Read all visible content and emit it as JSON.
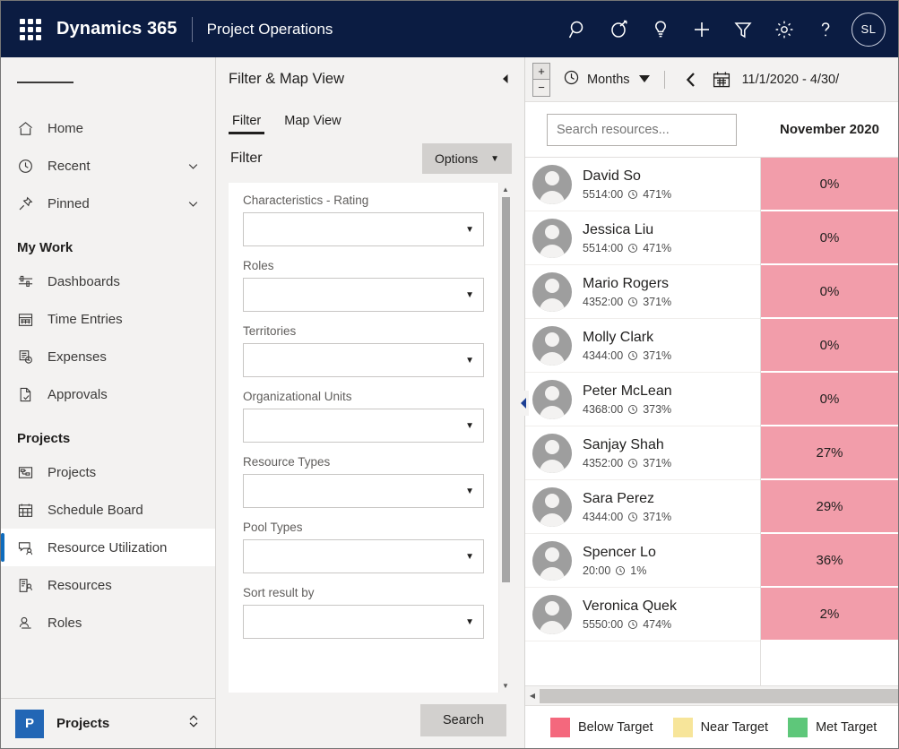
{
  "topbar": {
    "waffle_title": "App launcher",
    "brand": "Dynamics 365",
    "app_name": "Project Operations",
    "icons": [
      "search-icon",
      "assistant-icon",
      "idea-icon",
      "plus-icon",
      "filter-icon",
      "gear-icon",
      "help-icon"
    ],
    "avatar_initials": "SL",
    "background_color": "#0b1c42"
  },
  "sidebar": {
    "hamburger": "Expand/collapse navigation",
    "quick_items": [
      {
        "label": "Home",
        "icon": "home-icon",
        "chevron": false
      },
      {
        "label": "Recent",
        "icon": "clock-icon",
        "chevron": true
      },
      {
        "label": "Pinned",
        "icon": "pin-icon",
        "chevron": true
      }
    ],
    "groups": [
      {
        "title": "My Work",
        "items": [
          {
            "label": "Dashboards",
            "icon": "dashboard-icon",
            "selected": false
          },
          {
            "label": "Time Entries",
            "icon": "calendar-icon",
            "selected": false
          },
          {
            "label": "Expenses",
            "icon": "expenses-icon",
            "selected": false
          },
          {
            "label": "Approvals",
            "icon": "approvals-icon",
            "selected": false
          }
        ]
      },
      {
        "title": "Projects",
        "items": [
          {
            "label": "Projects",
            "icon": "projects-icon",
            "selected": false
          },
          {
            "label": "Schedule Board",
            "icon": "schedule-board-icon",
            "selected": false
          },
          {
            "label": "Resource Utilization",
            "icon": "resource-utilization-icon",
            "selected": true
          },
          {
            "label": "Resources",
            "icon": "resources-icon",
            "selected": false
          },
          {
            "label": "Roles",
            "icon": "roles-icon",
            "selected": false
          }
        ]
      }
    ],
    "footer": {
      "badge": "P",
      "label": "Projects",
      "switcher_icon": "up-down-chevron-icon"
    },
    "selected_accent_color": "#0f6cbd"
  },
  "filter_panel": {
    "title": "Filter & Map View",
    "collapse_icon": "chevron-left-icon",
    "tabs": [
      {
        "label": "Filter",
        "active": true
      },
      {
        "label": "Map View",
        "active": false
      }
    ],
    "section_title": "Filter",
    "options_button": {
      "label": "Options",
      "caret": "▼"
    },
    "fields": [
      {
        "label": "Characteristics - Rating",
        "value": "",
        "caret": "▼"
      },
      {
        "label": "Roles",
        "value": "",
        "caret": "▼"
      },
      {
        "label": "Territories",
        "value": "",
        "caret": "▼"
      },
      {
        "label": "Organizational Units",
        "value": "",
        "caret": "▼"
      },
      {
        "label": "Resource Types",
        "value": "",
        "caret": "▼"
      },
      {
        "label": "Pool Types",
        "value": "",
        "caret": "▼"
      },
      {
        "label": "Sort result by",
        "value": "",
        "caret": "▼"
      }
    ],
    "search_button": "Search",
    "splitter_icon": "collapse-handle-icon"
  },
  "toolbar": {
    "expand_all": "+",
    "collapse_all": "−",
    "unit_icon": "clock-icon",
    "unit_label": "Months",
    "unit_caret": "▼",
    "prev_icon": "chevron-left-icon",
    "calendar_icon": "calendar-icon",
    "date_range": "11/1/2020 - 4/30/"
  },
  "grid": {
    "search_placeholder": "Search resources...",
    "search_value": "",
    "month_header": "November 2020",
    "rows": [
      {
        "name": "David So",
        "hours": "5514:00",
        "pct": "471%",
        "utilization": "0%",
        "status": "below"
      },
      {
        "name": "Jessica Liu",
        "hours": "5514:00",
        "pct": "471%",
        "utilization": "0%",
        "status": "below"
      },
      {
        "name": "Mario Rogers",
        "hours": "4352:00",
        "pct": "371%",
        "utilization": "0%",
        "status": "below"
      },
      {
        "name": "Molly Clark",
        "hours": "4344:00",
        "pct": "371%",
        "utilization": "0%",
        "status": "below"
      },
      {
        "name": "Peter McLean",
        "hours": "4368:00",
        "pct": "373%",
        "utilization": "0%",
        "status": "below"
      },
      {
        "name": "Sanjay Shah",
        "hours": "4352:00",
        "pct": "371%",
        "utilization": "27%",
        "status": "below"
      },
      {
        "name": "Sara Perez",
        "hours": "4344:00",
        "pct": "371%",
        "utilization": "29%",
        "status": "below"
      },
      {
        "name": "Spencer Lo",
        "hours": "20:00",
        "pct": "1%",
        "utilization": "36%",
        "status": "below"
      },
      {
        "name": "Veronica Quek",
        "hours": "5550:00",
        "pct": "474%",
        "utilization": "2%",
        "status": "below"
      }
    ],
    "hscroll_arrow": "chevron-left-icon"
  },
  "legend": {
    "items": [
      {
        "label": "Below Target",
        "color": "#f4687d"
      },
      {
        "label": "Near Target",
        "color": "#f7e59a"
      },
      {
        "label": "Met Target",
        "color": "#5ec77a"
      }
    ]
  },
  "colors": {
    "below_target_cell": "#f29daa",
    "chrome": "#f3f2f1"
  }
}
